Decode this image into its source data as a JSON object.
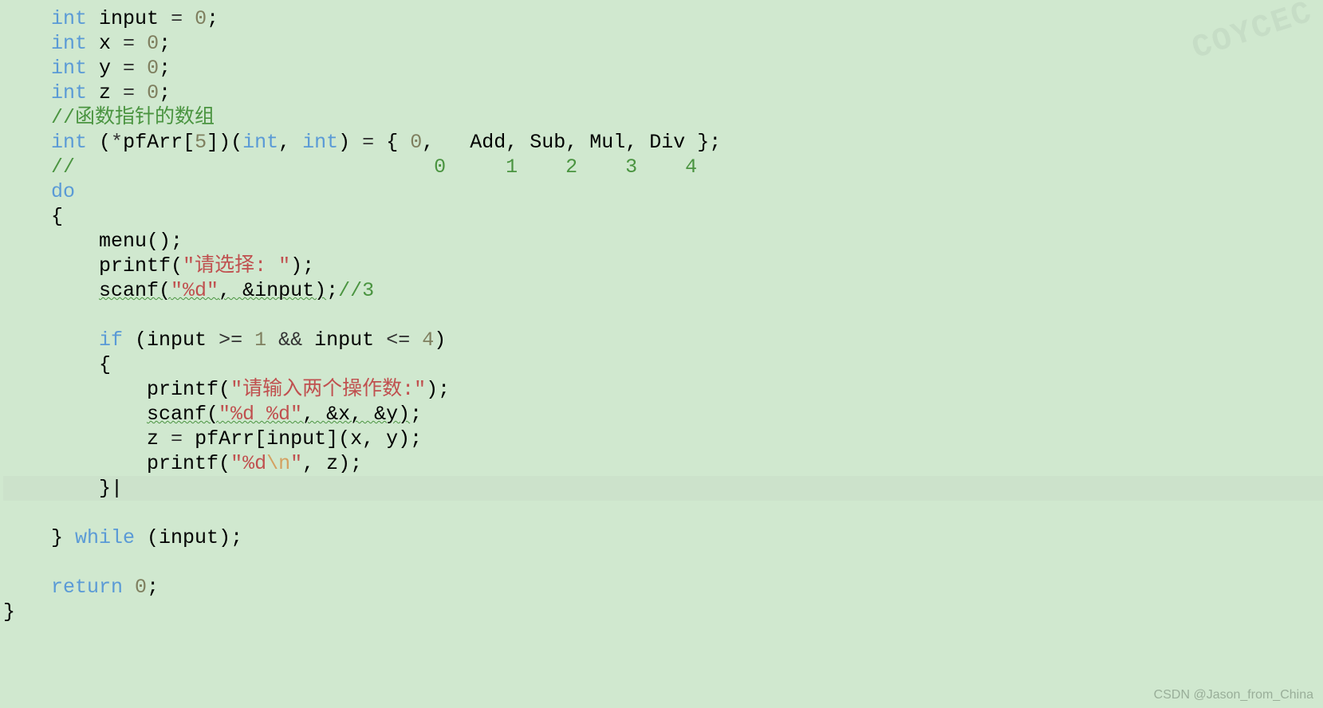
{
  "code": {
    "lines": [
      {
        "indent": "    ",
        "tokens": [
          {
            "t": "int",
            "c": "kw"
          },
          {
            "t": " input ",
            "c": ""
          },
          {
            "t": "=",
            "c": "op"
          },
          {
            "t": " ",
            "c": ""
          },
          {
            "t": "0",
            "c": "num"
          },
          {
            "t": ";",
            "c": ""
          }
        ]
      },
      {
        "indent": "    ",
        "tokens": [
          {
            "t": "int",
            "c": "kw"
          },
          {
            "t": " x ",
            "c": ""
          },
          {
            "t": "=",
            "c": "op"
          },
          {
            "t": " ",
            "c": ""
          },
          {
            "t": "0",
            "c": "num"
          },
          {
            "t": ";",
            "c": ""
          }
        ]
      },
      {
        "indent": "    ",
        "tokens": [
          {
            "t": "int",
            "c": "kw"
          },
          {
            "t": " y ",
            "c": ""
          },
          {
            "t": "=",
            "c": "op"
          },
          {
            "t": " ",
            "c": ""
          },
          {
            "t": "0",
            "c": "num"
          },
          {
            "t": ";",
            "c": ""
          }
        ]
      },
      {
        "indent": "    ",
        "tokens": [
          {
            "t": "int",
            "c": "kw"
          },
          {
            "t": " z ",
            "c": ""
          },
          {
            "t": "=",
            "c": "op"
          },
          {
            "t": " ",
            "c": ""
          },
          {
            "t": "0",
            "c": "num"
          },
          {
            "t": ";",
            "c": ""
          }
        ]
      },
      {
        "indent": "    ",
        "tokens": [
          {
            "t": "//函数指针的数组",
            "c": "comment"
          }
        ]
      },
      {
        "indent": "    ",
        "tokens": [
          {
            "t": "int",
            "c": "kw"
          },
          {
            "t": " (",
            "c": ""
          },
          {
            "t": "*",
            "c": "op"
          },
          {
            "t": "pfArr[",
            "c": ""
          },
          {
            "t": "5",
            "c": "num"
          },
          {
            "t": "])(",
            "c": ""
          },
          {
            "t": "int",
            "c": "kw"
          },
          {
            "t": ", ",
            "c": ""
          },
          {
            "t": "int",
            "c": "kw"
          },
          {
            "t": ") ",
            "c": ""
          },
          {
            "t": "=",
            "c": "op"
          },
          {
            "t": " { ",
            "c": ""
          },
          {
            "t": "0",
            "c": "num"
          },
          {
            "t": ",   Add, Sub, Mul, Div };",
            "c": ""
          }
        ]
      },
      {
        "indent": "    ",
        "tokens": [
          {
            "t": "//                              0     1    2    3    4",
            "c": "comment"
          }
        ]
      },
      {
        "indent": "    ",
        "tokens": [
          {
            "t": "do",
            "c": "kw"
          }
        ]
      },
      {
        "indent": "    ",
        "tokens": [
          {
            "t": "{",
            "c": ""
          }
        ]
      },
      {
        "indent": "        ",
        "tokens": [
          {
            "t": "menu();",
            "c": ""
          }
        ]
      },
      {
        "indent": "        ",
        "tokens": [
          {
            "t": "printf(",
            "c": ""
          },
          {
            "t": "\"请选择: \"",
            "c": "str"
          },
          {
            "t": ");",
            "c": ""
          }
        ]
      },
      {
        "indent": "        ",
        "tokens": [
          {
            "t": "scanf(",
            "c": "",
            "w": true
          },
          {
            "t": "\"%d\"",
            "c": "str",
            "w": true
          },
          {
            "t": ", &input)",
            "c": "",
            "w": true
          },
          {
            "t": ";",
            "c": ""
          },
          {
            "t": "//3",
            "c": "comment"
          }
        ]
      },
      {
        "indent": "",
        "tokens": []
      },
      {
        "indent": "        ",
        "tokens": [
          {
            "t": "if",
            "c": "kw"
          },
          {
            "t": " (input ",
            "c": ""
          },
          {
            "t": ">=",
            "c": "op"
          },
          {
            "t": " ",
            "c": ""
          },
          {
            "t": "1",
            "c": "num"
          },
          {
            "t": " ",
            "c": ""
          },
          {
            "t": "&&",
            "c": "op"
          },
          {
            "t": " input ",
            "c": ""
          },
          {
            "t": "<=",
            "c": "op"
          },
          {
            "t": " ",
            "c": ""
          },
          {
            "t": "4",
            "c": "num"
          },
          {
            "t": ")",
            "c": ""
          }
        ]
      },
      {
        "indent": "        ",
        "tokens": [
          {
            "t": "{",
            "c": ""
          }
        ]
      },
      {
        "indent": "            ",
        "tokens": [
          {
            "t": "printf(",
            "c": ""
          },
          {
            "t": "\"请输入两个操作数:\"",
            "c": "str"
          },
          {
            "t": ");",
            "c": ""
          }
        ]
      },
      {
        "indent": "            ",
        "tokens": [
          {
            "t": "scanf(",
            "c": "",
            "w": true
          },
          {
            "t": "\"%d %d\"",
            "c": "str",
            "w": true
          },
          {
            "t": ", &x, &y)",
            "c": "",
            "w": true
          },
          {
            "t": ";",
            "c": ""
          }
        ]
      },
      {
        "indent": "            ",
        "tokens": [
          {
            "t": "z ",
            "c": ""
          },
          {
            "t": "=",
            "c": "op"
          },
          {
            "t": " pfArr[input](x, y);",
            "c": ""
          }
        ]
      },
      {
        "indent": "            ",
        "tokens": [
          {
            "t": "printf(",
            "c": ""
          },
          {
            "t": "\"%d",
            "c": "str"
          },
          {
            "t": "\\n",
            "c": "esc"
          },
          {
            "t": "\"",
            "c": "str"
          },
          {
            "t": ", z);",
            "c": ""
          }
        ]
      },
      {
        "indent": "        ",
        "tokens": [
          {
            "t": "}|",
            "c": ""
          }
        ],
        "current": true
      },
      {
        "indent": "",
        "tokens": []
      },
      {
        "indent": "    ",
        "tokens": [
          {
            "t": "} ",
            "c": ""
          },
          {
            "t": "while",
            "c": "kw"
          },
          {
            "t": " (input);",
            "c": ""
          }
        ]
      },
      {
        "indent": "",
        "tokens": []
      },
      {
        "indent": "    ",
        "tokens": [
          {
            "t": "return",
            "c": "kw"
          },
          {
            "t": " ",
            "c": ""
          },
          {
            "t": "0",
            "c": "num"
          },
          {
            "t": ";",
            "c": ""
          }
        ]
      },
      {
        "indent": "",
        "tokens": [
          {
            "t": "}",
            "c": ""
          }
        ]
      }
    ]
  },
  "watermark_top": "COYCEC",
  "watermark_bottom": "CSDN @Jason_from_China",
  "cursor_position": {
    "line": 19,
    "col": 30
  }
}
